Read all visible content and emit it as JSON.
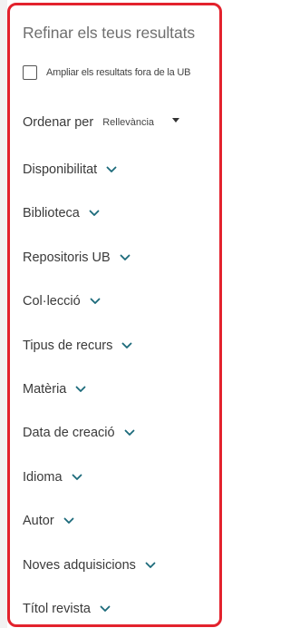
{
  "panel": {
    "title": "Refinar els teus resultats"
  },
  "expand": {
    "label": "Ampliar els resultats fora de la UB",
    "checked": false
  },
  "sort": {
    "label": "Ordenar per",
    "selected": "Rellevància",
    "icon": "caret-down-icon"
  },
  "facets": [
    {
      "label": "Disponibilitat",
      "icon": "chevron-down-icon"
    },
    {
      "label": "Biblioteca",
      "icon": "chevron-down-icon"
    },
    {
      "label": "Repositoris UB",
      "icon": "chevron-down-icon"
    },
    {
      "label": "Col·lecció",
      "icon": "chevron-down-icon"
    },
    {
      "label": "Tipus de recurs",
      "icon": "chevron-down-icon"
    },
    {
      "label": "Matèria",
      "icon": "chevron-down-icon"
    },
    {
      "label": "Data de creació",
      "icon": "chevron-down-icon"
    },
    {
      "label": "Idioma",
      "icon": "chevron-down-icon"
    },
    {
      "label": "Autor",
      "icon": "chevron-down-icon"
    },
    {
      "label": "Noves adquisicions",
      "icon": "chevron-down-icon"
    },
    {
      "label": "Títol revista",
      "icon": "chevron-down-icon"
    }
  ],
  "colors": {
    "border": "#e3222d",
    "chevron": "#1b6a7a",
    "title": "#6f6f6f",
    "text": "#3a3a3a"
  }
}
